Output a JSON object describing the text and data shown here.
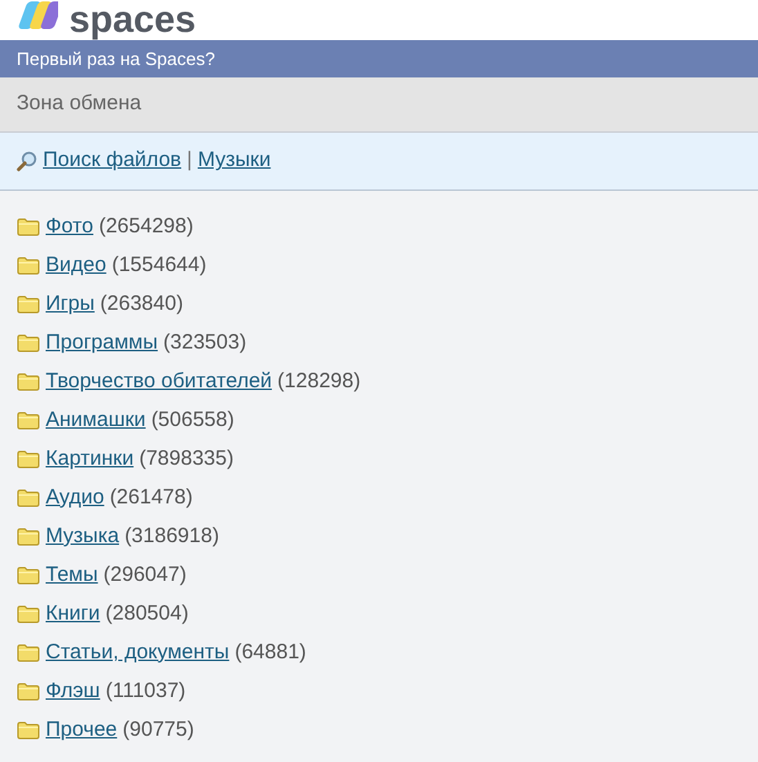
{
  "logo": {
    "text": "spaces"
  },
  "banner": {
    "text": "Первый раз на Spaces?"
  },
  "section_title": "Зона обмена",
  "links": [
    {
      "text": "Поиск файлов"
    },
    {
      "text": "Музыки"
    }
  ],
  "link_separator": "|",
  "categories": [
    {
      "name": "Фото",
      "count": "(2654298)"
    },
    {
      "name": "Видео",
      "count": "(1554644)"
    },
    {
      "name": "Игры",
      "count": "(263840)"
    },
    {
      "name": "Программы",
      "count": "(323503)"
    },
    {
      "name": "Творчество обитателей",
      "count": "(128298)"
    },
    {
      "name": "Анимашки",
      "count": "(506558)"
    },
    {
      "name": "Картинки",
      "count": "(7898335)"
    },
    {
      "name": "Аудио",
      "count": "(261478)"
    },
    {
      "name": "Музыка",
      "count": "(3186918)"
    },
    {
      "name": "Темы",
      "count": "(296047)"
    },
    {
      "name": "Книги",
      "count": "(280504)"
    },
    {
      "name": "Статьи, документы",
      "count": "(64881)"
    },
    {
      "name": "Флэш",
      "count": "(111037)"
    },
    {
      "name": "Прочее",
      "count": "(90775)"
    }
  ]
}
